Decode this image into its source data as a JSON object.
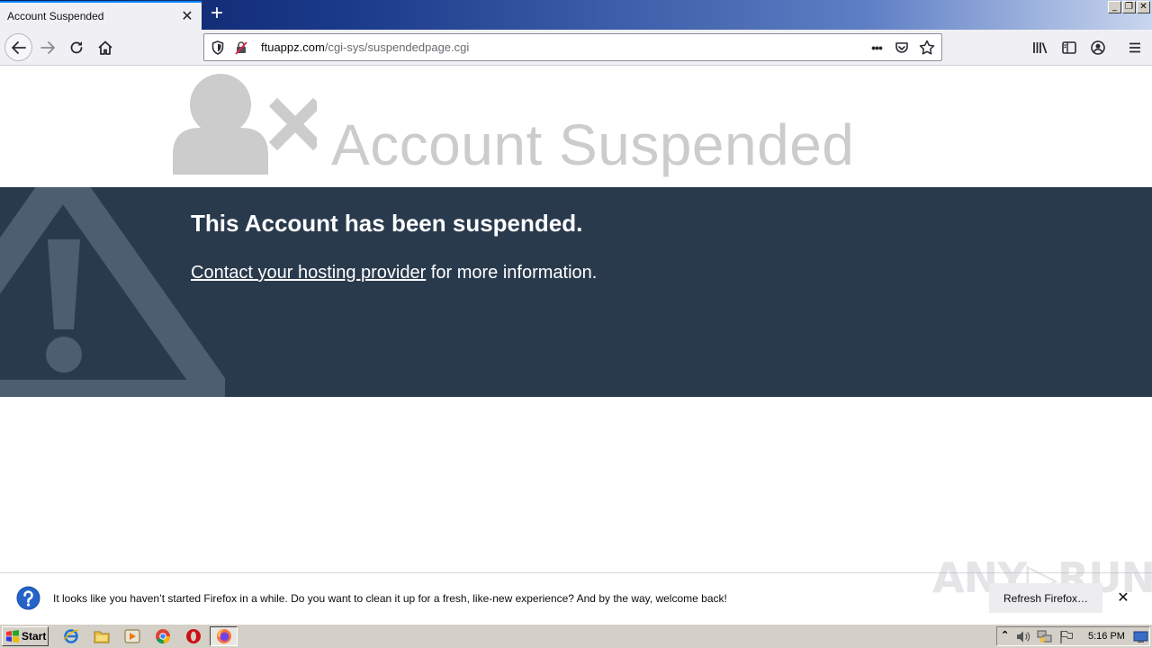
{
  "browser": {
    "tab_title": "Account Suspended",
    "tab_close": "✕",
    "new_tab": "+",
    "window_controls": [
      "_",
      "❐",
      "✕"
    ],
    "url_domain": "ftuappz.com",
    "url_path": "/cgi-sys/suspendedpage.cgi",
    "page_actions": "•••"
  },
  "page": {
    "hero_title": "Account Suspended",
    "heading": "This Account has been suspended.",
    "link_text": "Contact your hosting provider",
    "after_link": " for more information.",
    "banner_color": "#2a3a4d"
  },
  "notification": {
    "text": "It looks like you haven’t started Firefox in a while. Do you want to clean it up for a fresh, like-new experience? And by the way, welcome back!",
    "button": "Refresh Firefox…",
    "close": "✕",
    "watermark": "ANY▷RUN"
  },
  "taskbar": {
    "start_label": "Start",
    "clock": "5:16 PM"
  }
}
